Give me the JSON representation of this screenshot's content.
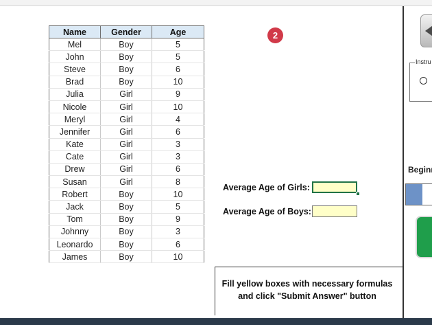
{
  "table": {
    "headers": {
      "name": "Name",
      "gender": "Gender",
      "age": "Age"
    },
    "rows": [
      {
        "name": "Mel",
        "gender": "Boy",
        "age": "5"
      },
      {
        "name": "John",
        "gender": "Boy",
        "age": "5"
      },
      {
        "name": "Steve",
        "gender": "Boy",
        "age": "6"
      },
      {
        "name": "Brad",
        "gender": "Boy",
        "age": "10"
      },
      {
        "name": "Julia",
        "gender": "Girl",
        "age": "9"
      },
      {
        "name": "Nicole",
        "gender": "Girl",
        "age": "10"
      },
      {
        "name": "Meryl",
        "gender": "Girl",
        "age": "4"
      },
      {
        "name": "Jennifer",
        "gender": "Girl",
        "age": "6"
      },
      {
        "name": "Kate",
        "gender": "Girl",
        "age": "3"
      },
      {
        "name": "Cate",
        "gender": "Girl",
        "age": "3"
      },
      {
        "name": "Drew",
        "gender": "Girl",
        "age": "6"
      },
      {
        "name": "Susan",
        "gender": "Girl",
        "age": "8"
      },
      {
        "name": "Robert",
        "gender": "Boy",
        "age": "10"
      },
      {
        "name": "Jack",
        "gender": "Boy",
        "age": "5"
      },
      {
        "name": "Tom",
        "gender": "Boy",
        "age": "9"
      },
      {
        "name": "Johnny",
        "gender": "Boy",
        "age": "3"
      },
      {
        "name": "Leonardo",
        "gender": "Boy",
        "age": "6"
      },
      {
        "name": "James",
        "gender": "Boy",
        "age": "10"
      }
    ]
  },
  "step_badge": "2",
  "answers": {
    "girls_label": "Average Age of Girls:",
    "girls_value": "",
    "boys_label": "Average Age of Boys:",
    "boys_value": ""
  },
  "instruction": {
    "line1": "Fill yellow boxes with necessary formulas",
    "line2": "and click \"Submit Answer\" button"
  },
  "right_panel": {
    "instructions_label": "Instru",
    "level_label": "Beginn",
    "level_progress": 0.58,
    "level_fill_color": "#6d92c7",
    "submit_color": "#1f9e4b",
    "back_icon": "back-arrow-icon"
  },
  "colors": {
    "header_bg": "#dbe9f5",
    "answer_bg": "#ffffc8",
    "badge": "#d13a49",
    "active_border": "#217346"
  }
}
